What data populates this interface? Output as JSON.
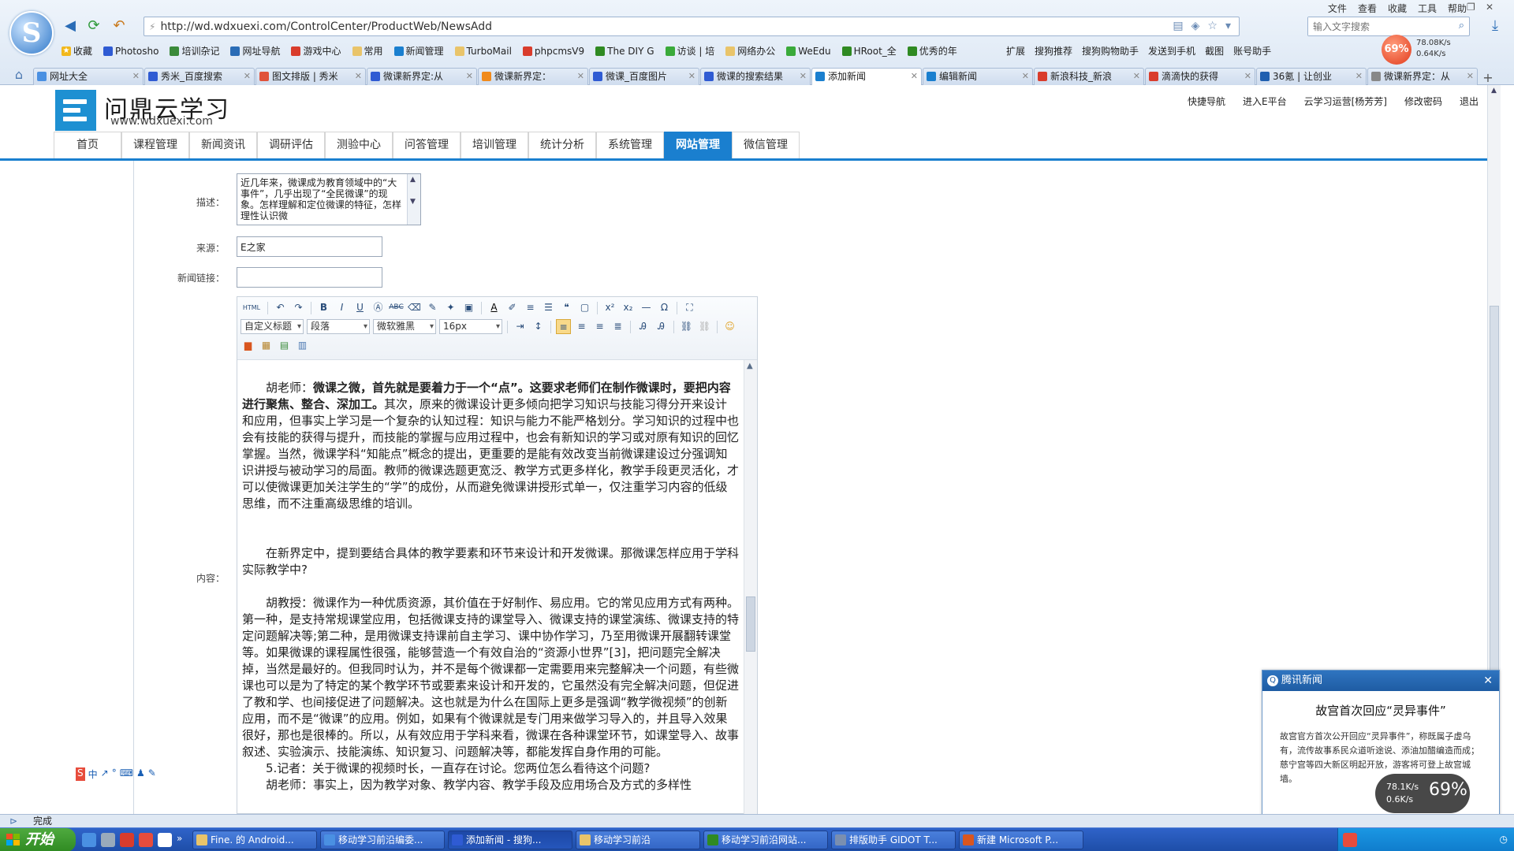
{
  "browser": {
    "url": "http://wd.wdxuexi.com/ControlCenter/ProductWeb/NewsAdd",
    "search_placeholder": "输入文字搜索",
    "menu": [
      "文件",
      "查看",
      "收藏",
      "工具",
      "帮助"
    ],
    "bookmarks": [
      "收藏",
      "Photosho",
      "培训杂记",
      "网址导航",
      "游戏中心",
      "常用",
      "新闻管理",
      "TurboMail",
      "phpcmsV9",
      "The DIY G",
      "访谈 | 培",
      "网络办公",
      "WeEdu",
      "HRoot_全",
      "优秀的年"
    ],
    "right_tools": [
      "扩展",
      "搜狗推荐",
      "搜狗购物助手",
      "发送到手机",
      "截图",
      "账号助手"
    ],
    "speed_ball": "69%",
    "speed_up": "78.08K/s",
    "speed_down": "0.64K/s",
    "tabs": [
      {
        "label": "网址大全",
        "color": "#4a90e2"
      },
      {
        "label": "秀米_百度搜索",
        "color": "#2f5bd3"
      },
      {
        "label": "图文排版 | 秀米",
        "color": "#e0523a"
      },
      {
        "label": "微课新界定:从",
        "color": "#2f5bd3"
      },
      {
        "label": "微课新界定：",
        "color": "#f08a1c"
      },
      {
        "label": "微课_百度图片",
        "color": "#2f5bd3"
      },
      {
        "label": "微课的搜索结果",
        "color": "#2f5bd3"
      },
      {
        "label": "添加新闻",
        "color": "#1a7fcf"
      },
      {
        "label": "编辑新闻",
        "color": "#1a7fcf"
      },
      {
        "label": "新浪科技_新浪",
        "color": "#d93c2c"
      },
      {
        "label": "滴滴快的获得",
        "color": "#d93c2c"
      },
      {
        "label": "36氪 | 让创业",
        "color": "#1f5fb0"
      },
      {
        "label": "微课新界定：从",
        "color": "#888888"
      }
    ],
    "active_tab_index": 7,
    "status_text": "完成"
  },
  "site": {
    "title": "问鼎云学习",
    "url_text": "www.wdxuexi.com",
    "quick_links": [
      "快捷导航",
      "进入E平台",
      "云学习运营[杨芳芳]",
      "修改密码",
      "退出"
    ],
    "nav": [
      "首页",
      "课程管理",
      "新闻资讯",
      "调研评估",
      "测验中心",
      "问答管理",
      "培训管理",
      "统计分析",
      "系统管理",
      "网站管理",
      "微信管理"
    ],
    "active_nav_index": 9
  },
  "form": {
    "desc_label": "描述：",
    "desc_value": "近几年来，微课成为教育领域中的“大事件”，几乎出现了“全民微课”的现象。怎样理解和定位微课的特征，怎样理性认识微",
    "source_label": "来源：",
    "source_value": "E之家",
    "link_label": "新闻链接：",
    "link_value": "",
    "content_label": "内容："
  },
  "editor": {
    "heading_select": "自定义标题",
    "paragraph_select": "段落",
    "font_select": "微软雅黑",
    "size_select": "16px",
    "html_btn": "HTML",
    "para1_bold": "微课之微，首先就是要着力于一个“点”。这要求老师们在制作微课时，要把内容进行聚焦、整合、深加工。",
    "para1_prefix": "胡老师：",
    "para1_rest": "其次，原来的微课设计更多倾向把学习知识与技能习得分开来设计和应用，但事实上学习是一个复杂的认知过程：知识与能力不能严格划分。学习知识的过程中也会有技能的获得与提升，而技能的掌握与应用过程中，也会有新知识的学习或对原有知识的回忆掌握。当然，微课学科“知能点”概念的提出，更重要的是能有效改变当前微课建设过分强调知识讲授与被动学习的局面。教师的微课选题更宽泛、教学方式更多样化，教学手段更灵活化，才可以使微课更加关注学生的“学”的成份，从而避免微课讲授形式单一，仅注重学习内容的低级思维，而不注重高级思维的培训。",
    "para2": "在新界定中，提到要结合具体的教学要素和环节来设计和开发微课。那微课怎样应用于学科实际教学中?",
    "para3": "胡教授：微课作为一种优质资源，其价值在于好制作、易应用。它的常见应用方式有两种。第一种，是支持常规课堂应用，包括微课支持的课堂导入、微课支持的课堂演练、微课支持的特定问题解决等;第二种，是用微课支持课前自主学习、课中协作学习，乃至用微课开展翻转课堂等。如果微课的课程属性很强，能够营造一个有效自治的“资源小世界”[3]，把问题完全解决掉，当然是最好的。但我同时认为，并不是每个微课都一定需要用来完整解决一个问题，有些微课也可以是为了特定的某个教学环节或要素来设计和开发的，它虽然没有完全解决问题，但促进了教和学、也间接促进了问题解决。这也就是为什么在国际上更多是强调“教学微视频”的创新应用，而不是“微课”的应用。例如，如果有个微课就是专门用来做学习导入的，并且导入效果很好，那也是很棒的。所以，从有效应用于学科来看，微课在各种课堂环节，如课堂导入、故事叙述、实验演示、技能演练、知识复习、问题解决等，都能发挥自身作用的可能。",
    "para4": "5.记者：关于微课的视频时长，一直存在讨论。您两位怎么看待这个问题?",
    "para5": "胡老师：事实上，因为教学对象、教学内容、教学手段及应用场合及方式的多样性"
  },
  "news_popup": {
    "header": "腾讯新闻",
    "title": "故宫首次回应“灵异事件”",
    "body": "故宫官方首次公开回应“灵异事件”，称既属子虚乌有，流传故事系民众道听途说、添油加醋编造而成；慈宁宫等四大新区明起开放，游客将可登上故宫城墙。"
  },
  "speed_widget": {
    "percent": "69%",
    "up": "78.1K/s",
    "down": "0.6K/s"
  },
  "taskbar": {
    "start": "开始",
    "tasks": [
      "Fine. 的 Android...",
      "移动学习前沿编委...",
      "添加新闻 - 搜狗...",
      "移动学习前沿",
      "移动学习前沿网站...",
      "排版助手 GIDOT T...",
      "新建 Microsoft P..."
    ],
    "active_task_index": 2
  }
}
